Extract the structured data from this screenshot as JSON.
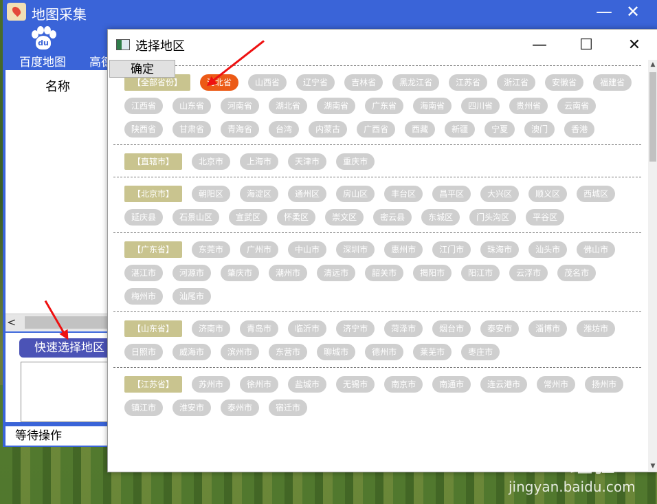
{
  "app": {
    "title": "地图采集",
    "minimize": "—",
    "close": "✕",
    "tool_baidu": "百度地图",
    "tool_gaode": "高德",
    "baidu_logo_text": "du",
    "column_header": "名称",
    "scroll_left": "<",
    "quick_select": "快速选择地区",
    "status": "等待操作"
  },
  "dialog": {
    "title": "选择地区",
    "minimize": "—",
    "maximize": "☐",
    "close": "✕",
    "ok": "确定",
    "scroll_up": "▲",
    "scroll_down": "▼",
    "sections": [
      {
        "header": "【全部省份】",
        "items": [
          "河北省",
          "山西省",
          "辽宁省",
          "吉林省",
          "黑龙江省",
          "江苏省",
          "浙江省",
          "安徽省",
          "福建省",
          "江西省",
          "山东省",
          "河南省",
          "湖北省",
          "湖南省",
          "广东省",
          "海南省",
          "四川省",
          "贵州省",
          "云南省",
          "陕西省",
          "甘肃省",
          "青海省",
          "台湾",
          "内蒙古",
          "广西省",
          "西藏",
          "新疆",
          "宁夏",
          "澳门",
          "香港"
        ],
        "selected": 0
      },
      {
        "header": "【直辖市】",
        "items": [
          "北京市",
          "上海市",
          "天津市",
          "重庆市"
        ]
      },
      {
        "header": "【北京市】",
        "items": [
          "朝阳区",
          "海淀区",
          "通州区",
          "房山区",
          "丰台区",
          "昌平区",
          "大兴区",
          "顺义区",
          "西城区",
          "延庆县",
          "石景山区",
          "宣武区",
          "怀柔区",
          "崇文区",
          "密云县",
          "东城区",
          "门头沟区",
          "平谷区"
        ]
      },
      {
        "header": "【广东省】",
        "items": [
          "东莞市",
          "广州市",
          "中山市",
          "深圳市",
          "惠州市",
          "江门市",
          "珠海市",
          "汕头市",
          "佛山市",
          "湛江市",
          "河源市",
          "肇庆市",
          "潮州市",
          "清远市",
          "韶关市",
          "揭阳市",
          "阳江市",
          "云浮市",
          "茂名市",
          "梅州市",
          "汕尾市"
        ]
      },
      {
        "header": "【山东省】",
        "items": [
          "济南市",
          "青岛市",
          "临沂市",
          "济宁市",
          "菏泽市",
          "烟台市",
          "泰安市",
          "淄博市",
          "潍坊市",
          "日照市",
          "威海市",
          "滨州市",
          "东营市",
          "聊城市",
          "德州市",
          "莱芜市",
          "枣庄市"
        ]
      },
      {
        "header": "【江苏省】",
        "items": [
          "苏州市",
          "徐州市",
          "盐城市",
          "无锡市",
          "南京市",
          "南通市",
          "连云港市",
          "常州市",
          "扬州市",
          "镇江市",
          "淮安市",
          "泰州市",
          "宿迁市"
        ]
      }
    ]
  },
  "watermark": {
    "logo": "Bai⚘经验",
    "url": "jingyan.baidu.com"
  },
  "colors": {
    "app_blue": "#3a64d8",
    "selected_chip": "#ec5a16",
    "header_chip": "#c9c48f",
    "chip": "#cfcfcf"
  }
}
